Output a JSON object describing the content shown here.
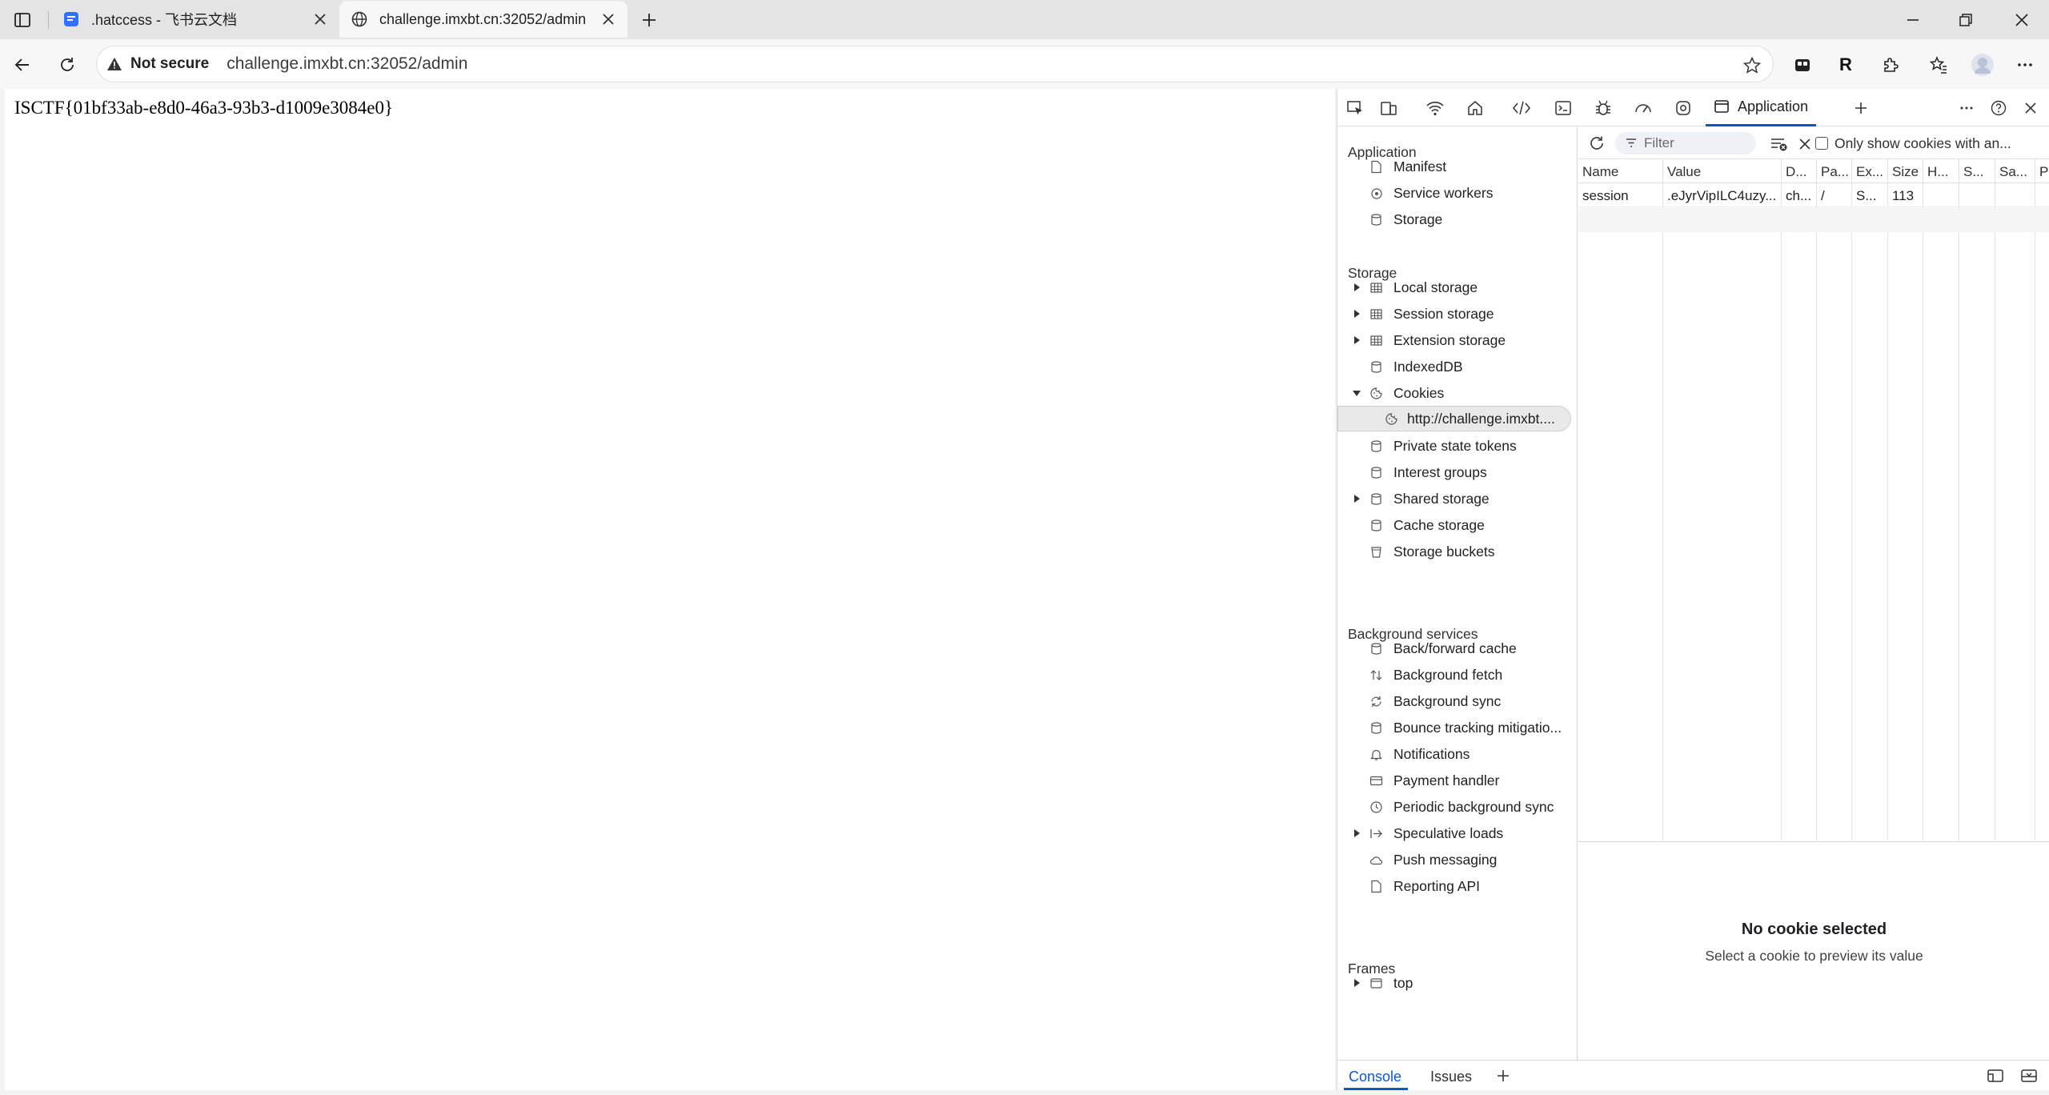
{
  "browser": {
    "tabs": [
      {
        "title": ".hatccess - 飞书云文档",
        "active": false
      },
      {
        "title": "challenge.imxbt.cn:32052/admin",
        "active": true
      }
    ],
    "security_label": "Not secure",
    "url": "challenge.imxbt.cn:32052/admin",
    "profile_letter": "R"
  },
  "page": {
    "flag_text": "ISCTF{01bf33ab-e8d0-46a3-93b3-d1009e3084e0}"
  },
  "devtools": {
    "active_panel": "Application",
    "sidebar": {
      "application_header": "Application",
      "application_items": [
        "Manifest",
        "Service workers",
        "Storage"
      ],
      "storage_header": "Storage",
      "storage_items": [
        "Local storage",
        "Session storage",
        "Extension storage",
        "IndexedDB",
        "Cookies",
        "http://challenge.imxbt....",
        "Private state tokens",
        "Interest groups",
        "Shared storage",
        "Cache storage",
        "Storage buckets"
      ],
      "background_header": "Background services",
      "background_items": [
        "Back/forward cache",
        "Background fetch",
        "Background sync",
        "Bounce tracking mitigatio...",
        "Notifications",
        "Payment handler",
        "Periodic background sync",
        "Speculative loads",
        "Push messaging",
        "Reporting API"
      ],
      "frames_header": "Frames",
      "frames_items": [
        "top"
      ]
    },
    "cookies_toolbar": {
      "filter_placeholder": "Filter",
      "only_show_label": "Only show cookies with an..."
    },
    "cookies_table": {
      "headers": [
        "Name",
        "Value",
        "D...",
        "Pa...",
        "Ex...",
        "Size",
        "H...",
        "S...",
        "Sa...",
        "P"
      ],
      "rows": [
        [
          "session",
          ".eJyrVipILC4uzy...",
          "ch...",
          "/",
          "S...",
          "113",
          "",
          "",
          "",
          ""
        ]
      ]
    },
    "preview": {
      "title": "No cookie selected",
      "subtitle": "Select a cookie to preview its value"
    },
    "drawer_tabs": [
      "Console",
      "Issues"
    ],
    "colors": {
      "accent": "#0b57d0",
      "selected_bg": "#e9e9e9"
    }
  }
}
